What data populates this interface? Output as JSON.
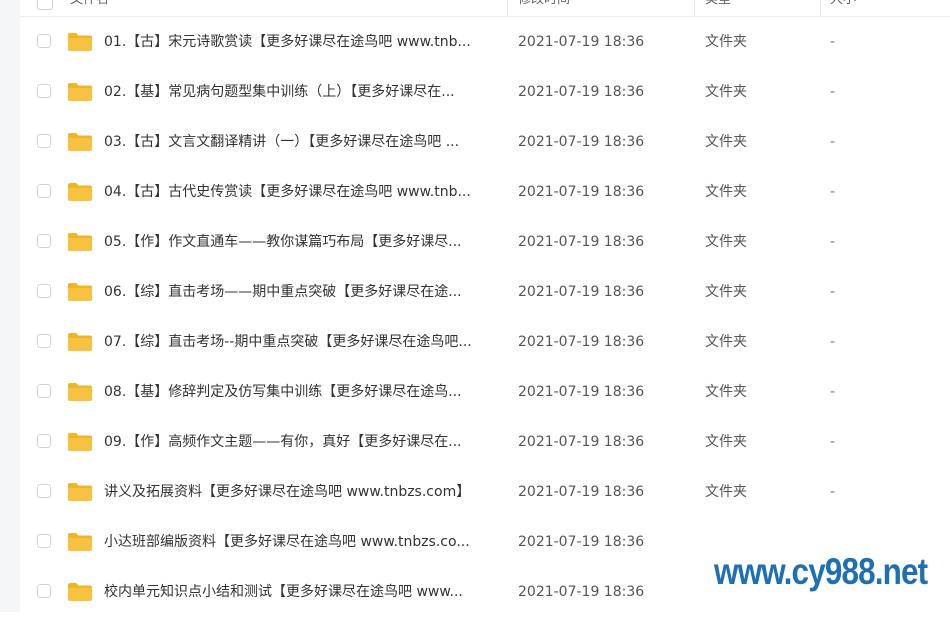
{
  "header": {
    "name": "文件名",
    "time": "修改时间",
    "type": "类型",
    "size": "大小"
  },
  "rows": [
    {
      "name": "01.【古】宋元诗歌赏读【更多好课尽在途鸟吧 www.tnb...",
      "time": "2021-07-19 18:36",
      "type": "文件夹",
      "size": "-"
    },
    {
      "name": "02.【基】常见病句题型集中训练（上）【更多好课尽在...",
      "time": "2021-07-19 18:36",
      "type": "文件夹",
      "size": "-"
    },
    {
      "name": "03.【古】文言文翻译精讲（一）【更多好课尽在途鸟吧 ...",
      "time": "2021-07-19 18:36",
      "type": "文件夹",
      "size": "-"
    },
    {
      "name": "04.【古】古代史传赏读【更多好课尽在途鸟吧 www.tnb...",
      "time": "2021-07-19 18:36",
      "type": "文件夹",
      "size": "-"
    },
    {
      "name": "05.【作】作文直通车——教你谋篇巧布局【更多好课尽...",
      "time": "2021-07-19 18:36",
      "type": "文件夹",
      "size": "-"
    },
    {
      "name": "06.【综】直击考场——期中重点突破【更多好课尽在途...",
      "time": "2021-07-19 18:36",
      "type": "文件夹",
      "size": "-"
    },
    {
      "name": "07.【综】直击考场--期中重点突破【更多好课尽在途鸟吧...",
      "time": "2021-07-19 18:36",
      "type": "文件夹",
      "size": "-"
    },
    {
      "name": "08.【基】修辞判定及仿写集中训练【更多好课尽在途鸟...",
      "time": "2021-07-19 18:36",
      "type": "文件夹",
      "size": "-"
    },
    {
      "name": "09.【作】高频作文主题——有你，真好【更多好课尽在...",
      "time": "2021-07-19 18:36",
      "type": "文件夹",
      "size": "-"
    },
    {
      "name": "讲义及拓展资料【更多好课尽在途鸟吧 www.tnbzs.com】",
      "time": "2021-07-19 18:36",
      "type": "文件夹",
      "size": "-"
    },
    {
      "name": "小达班部编版资料【更多好课尽在途鸟吧 www.tnbzs.co...",
      "time": "2021-07-19 18:36",
      "type": "",
      "size": ""
    },
    {
      "name": "校内单元知识点小结和测试【更多好课尽在途鸟吧 www...",
      "time": "2021-07-19 18:36",
      "type": "",
      "size": ""
    }
  ],
  "watermark": "www.cy988.net",
  "colors": {
    "folder": "#f7c242",
    "folder_dark": "#f0b429",
    "watermark": "#1f6fb3"
  }
}
